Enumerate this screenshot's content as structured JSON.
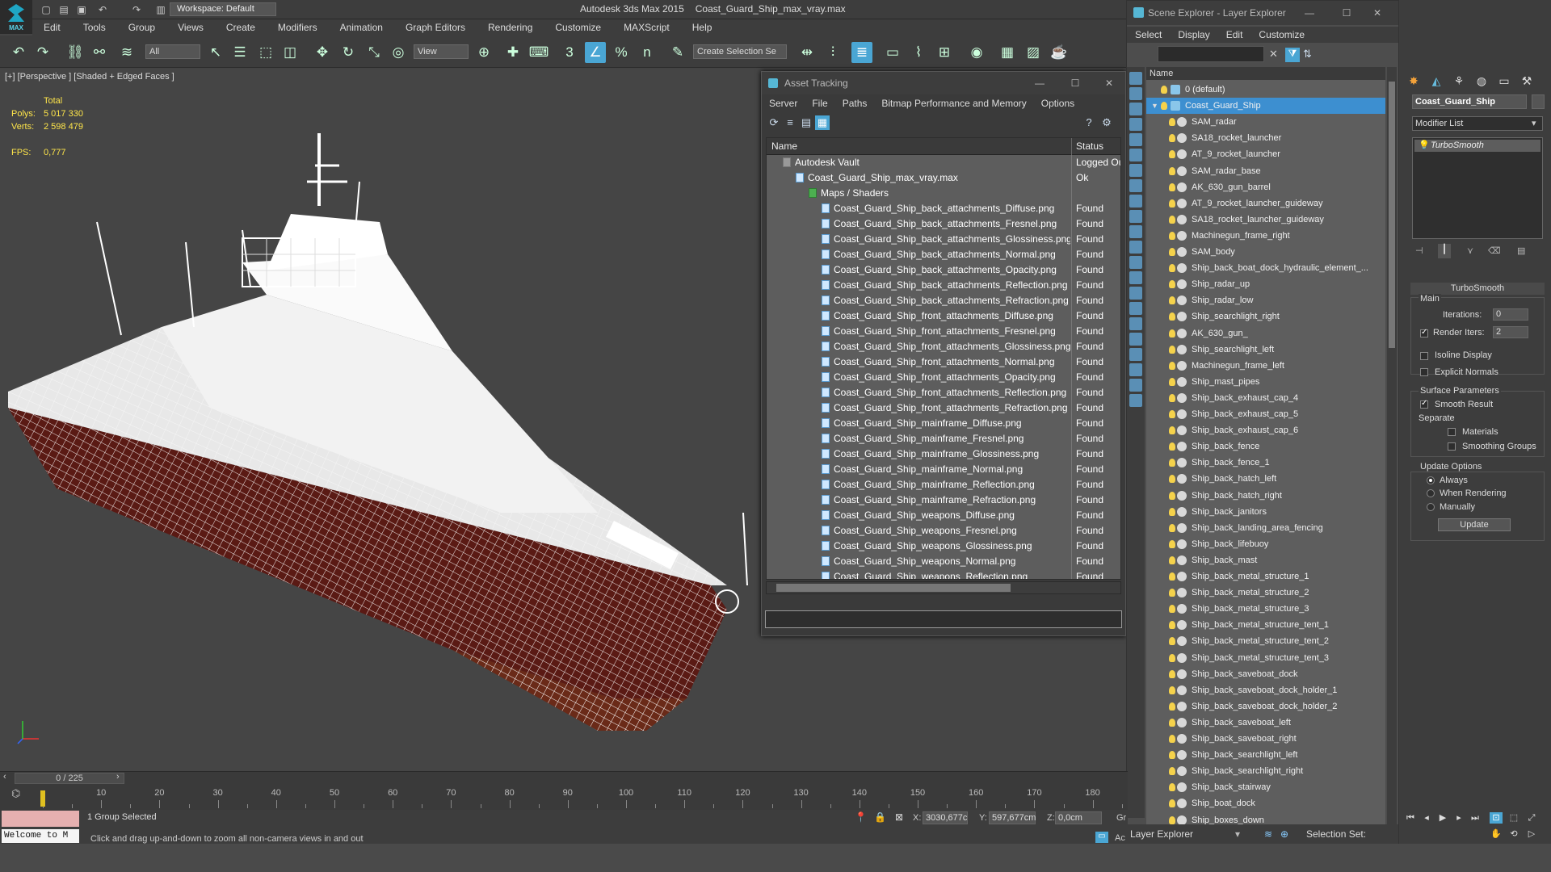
{
  "app": {
    "title": "Autodesk 3ds Max  2015",
    "file": "Coast_Guard_Ship_max_vray.max",
    "logo_text": "MAX",
    "workspace": "Workspace: Default"
  },
  "menu": [
    "Edit",
    "Tools",
    "Group",
    "Views",
    "Create",
    "Modifiers",
    "Animation",
    "Graph Editors",
    "Rendering",
    "Customize",
    "MAXScript",
    "Help"
  ],
  "toolbar": {
    "selection_filter": "All",
    "ref_coord": "View",
    "named_selection": "Create Selection Se",
    "snap_labels": [
      "3",
      "%",
      "n"
    ]
  },
  "viewport": {
    "label": "[+] [Perspective ] [Shaded + Edged Faces ]",
    "stats_header": "Total",
    "polys_label": "Polys:",
    "polys_value": "5 017 330",
    "verts_label": "Verts:",
    "verts_value": "2 598 479",
    "fps_label": "FPS:",
    "fps_value": "0,777"
  },
  "timeline": {
    "frame": "0 / 225",
    "ticks": [
      "10",
      "20",
      "30",
      "40",
      "50",
      "60",
      "70",
      "80",
      "90",
      "100",
      "110",
      "120",
      "130",
      "140",
      "150",
      "160",
      "170",
      "180"
    ]
  },
  "status": {
    "welcome": "Welcome to M",
    "selection": "1 Group Selected",
    "prompt": "Click and drag up-and-down to zoom all non-camera views in and out",
    "x_label": "X:",
    "x_value": "3030,677c",
    "y_label": "Y:",
    "y_value": "597,677cm",
    "z_label": "Z:",
    "z_value": "0,0cm",
    "grid_label": "Gr",
    "add_label": "Ac"
  },
  "asset_tracking": {
    "title": "Asset Tracking",
    "menu": [
      "Server",
      "File",
      "Paths",
      "Bitmap Performance and Memory",
      "Options"
    ],
    "col_name": "Name",
    "col_status": "Status",
    "rows": [
      {
        "name": "Autodesk Vault",
        "status": "Logged Out",
        "indent": 1
      },
      {
        "name": "Coast_Guard_Ship_max_vray.max",
        "status": "Ok",
        "indent": 2
      },
      {
        "name": "Maps / Shaders",
        "status": "",
        "indent": 3
      },
      {
        "name": "Coast_Guard_Ship_back_attachments_Diffuse.png",
        "status": "Found",
        "indent": 4
      },
      {
        "name": "Coast_Guard_Ship_back_attachments_Fresnel.png",
        "status": "Found",
        "indent": 4
      },
      {
        "name": "Coast_Guard_Ship_back_attachments_Glossiness.png",
        "status": "Found",
        "indent": 4
      },
      {
        "name": "Coast_Guard_Ship_back_attachments_Normal.png",
        "status": "Found",
        "indent": 4
      },
      {
        "name": "Coast_Guard_Ship_back_attachments_Opacity.png",
        "status": "Found",
        "indent": 4
      },
      {
        "name": "Coast_Guard_Ship_back_attachments_Reflection.png",
        "status": "Found",
        "indent": 4
      },
      {
        "name": "Coast_Guard_Ship_back_attachments_Refraction.png",
        "status": "Found",
        "indent": 4
      },
      {
        "name": "Coast_Guard_Ship_front_attachments_Diffuse.png",
        "status": "Found",
        "indent": 4
      },
      {
        "name": "Coast_Guard_Ship_front_attachments_Fresnel.png",
        "status": "Found",
        "indent": 4
      },
      {
        "name": "Coast_Guard_Ship_front_attachments_Glossiness.png",
        "status": "Found",
        "indent": 4
      },
      {
        "name": "Coast_Guard_Ship_front_attachments_Normal.png",
        "status": "Found",
        "indent": 4
      },
      {
        "name": "Coast_Guard_Ship_front_attachments_Opacity.png",
        "status": "Found",
        "indent": 4
      },
      {
        "name": "Coast_Guard_Ship_front_attachments_Reflection.png",
        "status": "Found",
        "indent": 4
      },
      {
        "name": "Coast_Guard_Ship_front_attachments_Refraction.png",
        "status": "Found",
        "indent": 4
      },
      {
        "name": "Coast_Guard_Ship_mainframe_Diffuse.png",
        "status": "Found",
        "indent": 4
      },
      {
        "name": "Coast_Guard_Ship_mainframe_Fresnel.png",
        "status": "Found",
        "indent": 4
      },
      {
        "name": "Coast_Guard_Ship_mainframe_Glossiness.png",
        "status": "Found",
        "indent": 4
      },
      {
        "name": "Coast_Guard_Ship_mainframe_Normal.png",
        "status": "Found",
        "indent": 4
      },
      {
        "name": "Coast_Guard_Ship_mainframe_Reflection.png",
        "status": "Found",
        "indent": 4
      },
      {
        "name": "Coast_Guard_Ship_mainframe_Refraction.png",
        "status": "Found",
        "indent": 4
      },
      {
        "name": "Coast_Guard_Ship_weapons_Diffuse.png",
        "status": "Found",
        "indent": 4
      },
      {
        "name": "Coast_Guard_Ship_weapons_Fresnel.png",
        "status": "Found",
        "indent": 4
      },
      {
        "name": "Coast_Guard_Ship_weapons_Glossiness.png",
        "status": "Found",
        "indent": 4
      },
      {
        "name": "Coast_Guard_Ship_weapons_Normal.png",
        "status": "Found",
        "indent": 4
      },
      {
        "name": "Coast_Guard_Ship_weapons_Reflection.png",
        "status": "Found",
        "indent": 4
      }
    ]
  },
  "scene_explorer": {
    "title": "Scene Explorer - Layer Explorer",
    "menu": [
      "Select",
      "Display",
      "Edit",
      "Customize"
    ],
    "col_name": "Name",
    "footer_left": "Layer Explorer",
    "footer_right": "Selection Set:",
    "items": [
      {
        "label": "0 (default)",
        "level": 0,
        "selected": false
      },
      {
        "label": "Coast_Guard_Ship",
        "level": 0,
        "selected": true
      },
      {
        "label": "SAM_radar",
        "level": 1,
        "selected": false
      },
      {
        "label": "SA18_rocket_launcher",
        "level": 1,
        "selected": false
      },
      {
        "label": "AT_9_rocket_launcher",
        "level": 1,
        "selected": false
      },
      {
        "label": "SAM_radar_base",
        "level": 1,
        "selected": false
      },
      {
        "label": "AK_630_gun_barrel",
        "level": 1,
        "selected": false
      },
      {
        "label": "AT_9_rocket_launcher_guideway",
        "level": 1,
        "selected": false
      },
      {
        "label": "SA18_rocket_launcher_guideway",
        "level": 1,
        "selected": false
      },
      {
        "label": "Machinegun_frame_right",
        "level": 1,
        "selected": false
      },
      {
        "label": "SAM_body",
        "level": 1,
        "selected": false
      },
      {
        "label": "Ship_back_boat_dock_hydraulic_element_...",
        "level": 1,
        "selected": false
      },
      {
        "label": "Ship_radar_up",
        "level": 1,
        "selected": false
      },
      {
        "label": "Ship_radar_low",
        "level": 1,
        "selected": false
      },
      {
        "label": "Ship_searchlight_right",
        "level": 1,
        "selected": false
      },
      {
        "label": "AK_630_gun_",
        "level": 1,
        "selected": false
      },
      {
        "label": "Ship_searchlight_left",
        "level": 1,
        "selected": false
      },
      {
        "label": "Machinegun_frame_left",
        "level": 1,
        "selected": false
      },
      {
        "label": "Ship_mast_pipes",
        "level": 1,
        "selected": false
      },
      {
        "label": "Ship_back_exhaust_cap_4",
        "level": 1,
        "selected": false
      },
      {
        "label": "Ship_back_exhaust_cap_5",
        "level": 1,
        "selected": false
      },
      {
        "label": "Ship_back_exhaust_cap_6",
        "level": 1,
        "selected": false
      },
      {
        "label": "Ship_back_fence",
        "level": 1,
        "selected": false
      },
      {
        "label": "Ship_back_fence_1",
        "level": 1,
        "selected": false
      },
      {
        "label": "Ship_back_hatch_left",
        "level": 1,
        "selected": false
      },
      {
        "label": "Ship_back_hatch_right",
        "level": 1,
        "selected": false
      },
      {
        "label": "Ship_back_janitors",
        "level": 1,
        "selected": false
      },
      {
        "label": "Ship_back_landing_area_fencing",
        "level": 1,
        "selected": false
      },
      {
        "label": "Ship_back_lifebuoy",
        "level": 1,
        "selected": false
      },
      {
        "label": "Ship_back_mast",
        "level": 1,
        "selected": false
      },
      {
        "label": "Ship_back_metal_structure_1",
        "level": 1,
        "selected": false
      },
      {
        "label": "Ship_back_metal_structure_2",
        "level": 1,
        "selected": false
      },
      {
        "label": "Ship_back_metal_structure_3",
        "level": 1,
        "selected": false
      },
      {
        "label": "Ship_back_metal_structure_tent_1",
        "level": 1,
        "selected": false
      },
      {
        "label": "Ship_back_metal_structure_tent_2",
        "level": 1,
        "selected": false
      },
      {
        "label": "Ship_back_metal_structure_tent_3",
        "level": 1,
        "selected": false
      },
      {
        "label": "Ship_back_saveboat_dock",
        "level": 1,
        "selected": false
      },
      {
        "label": "Ship_back_saveboat_dock_holder_1",
        "level": 1,
        "selected": false
      },
      {
        "label": "Ship_back_saveboat_dock_holder_2",
        "level": 1,
        "selected": false
      },
      {
        "label": "Ship_back_saveboat_left",
        "level": 1,
        "selected": false
      },
      {
        "label": "Ship_back_saveboat_right",
        "level": 1,
        "selected": false
      },
      {
        "label": "Ship_back_searchlight_left",
        "level": 1,
        "selected": false
      },
      {
        "label": "Ship_back_searchlight_right",
        "level": 1,
        "selected": false
      },
      {
        "label": "Ship_back_stairway",
        "level": 1,
        "selected": false
      },
      {
        "label": "Ship_boat_dock",
        "level": 1,
        "selected": false
      },
      {
        "label": "Ship_boxes_down",
        "level": 1,
        "selected": false
      }
    ]
  },
  "command_panel": {
    "object_name": "Coast_Guard_Ship",
    "modifier_list": "Modifier List",
    "stack_item": "TurboSmooth",
    "rollout_title": "TurboSmooth",
    "main_label": "Main",
    "iterations_label": "Iterations:",
    "iterations_value": "0",
    "render_iters_label": "Render Iters:",
    "render_iters_value": "2",
    "isoline_label": "Isoline Display",
    "explicit_label": "Explicit Normals",
    "surface_label": "Surface Parameters",
    "smooth_label": "Smooth Result",
    "separate_label": "Separate",
    "materials_label": "Materials",
    "smoothing_label": "Smoothing Groups",
    "update_label": "Update Options",
    "always_label": "Always",
    "when_rendering_label": "When Rendering",
    "manually_label": "Manually",
    "update_button": "Update"
  },
  "colors": {
    "accent": "#3d8fd0",
    "hull_red": "#5a1a14",
    "wire": "#ffffff",
    "stats_yellow": "#ffe64a"
  }
}
